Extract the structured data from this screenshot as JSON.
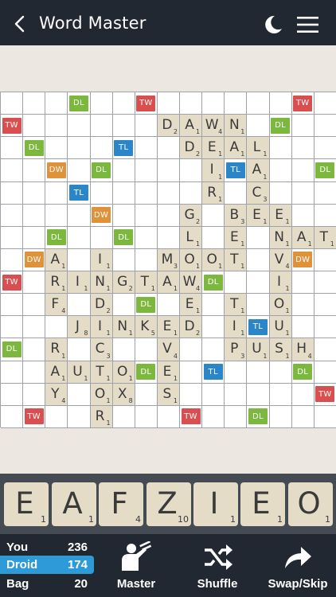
{
  "header": {
    "title": "Word Master"
  },
  "board": {
    "bonus": [
      [
        0,
        3,
        "DL"
      ],
      [
        0,
        6,
        "TW"
      ],
      [
        0,
        13,
        "TW"
      ],
      [
        1,
        0,
        "TW"
      ],
      [
        1,
        12,
        "DL"
      ],
      [
        2,
        1,
        "DL"
      ],
      [
        2,
        5,
        "TL"
      ],
      [
        3,
        2,
        "DW"
      ],
      [
        3,
        4,
        "DL"
      ],
      [
        3,
        10,
        "TL"
      ],
      [
        3,
        14,
        "DL"
      ],
      [
        4,
        3,
        "TL"
      ],
      [
        5,
        4,
        "DW"
      ],
      [
        6,
        2,
        "DL"
      ],
      [
        6,
        5,
        "DL"
      ],
      [
        7,
        1,
        "DW"
      ],
      [
        7,
        13,
        "DW"
      ],
      [
        8,
        0,
        "TW"
      ],
      [
        8,
        9,
        "DL"
      ],
      [
        9,
        6,
        "DL"
      ],
      [
        10,
        11,
        "TL"
      ],
      [
        11,
        0,
        "DL"
      ],
      [
        12,
        6,
        "DL"
      ],
      [
        12,
        9,
        "TL"
      ],
      [
        12,
        13,
        "DL"
      ],
      [
        13,
        14,
        "TW"
      ],
      [
        14,
        1,
        "TW"
      ],
      [
        14,
        8,
        "TW"
      ],
      [
        14,
        11,
        "DL"
      ]
    ],
    "tiles": [
      [
        1,
        7,
        "D",
        "2"
      ],
      [
        1,
        8,
        "A",
        "1"
      ],
      [
        1,
        9,
        "W",
        "4"
      ],
      [
        1,
        10,
        "N",
        "1"
      ],
      [
        2,
        8,
        "D",
        "2"
      ],
      [
        2,
        9,
        "E",
        "1"
      ],
      [
        2,
        10,
        "A",
        "1"
      ],
      [
        2,
        11,
        "L",
        "1"
      ],
      [
        3,
        9,
        "I",
        "1"
      ],
      [
        3,
        11,
        "A",
        "1"
      ],
      [
        4,
        9,
        "R",
        "1"
      ],
      [
        4,
        11,
        "C",
        "3"
      ],
      [
        5,
        8,
        "G",
        "2"
      ],
      [
        5,
        10,
        "B",
        "3"
      ],
      [
        5,
        11,
        "E",
        "1"
      ],
      [
        5,
        12,
        "E",
        "1"
      ],
      [
        6,
        8,
        "L",
        "1"
      ],
      [
        6,
        10,
        "E",
        "1"
      ],
      [
        6,
        12,
        "N",
        "1"
      ],
      [
        6,
        13,
        "A",
        "1"
      ],
      [
        6,
        14,
        "T",
        "1"
      ],
      [
        7,
        2,
        "A",
        "1"
      ],
      [
        7,
        4,
        "I",
        "1"
      ],
      [
        7,
        7,
        "M",
        "3"
      ],
      [
        7,
        8,
        "O",
        "1"
      ],
      [
        7,
        9,
        "O",
        "1"
      ],
      [
        7,
        10,
        "T",
        "1"
      ],
      [
        7,
        12,
        "V",
        "4"
      ],
      [
        8,
        2,
        "R",
        "1"
      ],
      [
        8,
        3,
        "I",
        "1"
      ],
      [
        8,
        4,
        "N",
        "1"
      ],
      [
        8,
        5,
        "G",
        "2"
      ],
      [
        8,
        6,
        "T",
        "1"
      ],
      [
        8,
        7,
        "A",
        "1"
      ],
      [
        8,
        8,
        "W",
        "4"
      ],
      [
        8,
        12,
        "I",
        "1"
      ],
      [
        9,
        2,
        "F",
        "4"
      ],
      [
        9,
        4,
        "D",
        "2"
      ],
      [
        9,
        8,
        "E",
        "1"
      ],
      [
        9,
        10,
        "T",
        "1"
      ],
      [
        9,
        12,
        "O",
        "1"
      ],
      [
        10,
        3,
        "J",
        "8"
      ],
      [
        10,
        4,
        "I",
        "1"
      ],
      [
        10,
        5,
        "N",
        "1"
      ],
      [
        10,
        6,
        "K",
        "5"
      ],
      [
        10,
        7,
        "E",
        "1"
      ],
      [
        10,
        8,
        "D",
        "2"
      ],
      [
        10,
        10,
        "I",
        "1"
      ],
      [
        10,
        12,
        "U",
        "1"
      ],
      [
        11,
        2,
        "R",
        "1"
      ],
      [
        11,
        4,
        "C",
        "3"
      ],
      [
        11,
        7,
        "V",
        "4"
      ],
      [
        11,
        10,
        "P",
        "3"
      ],
      [
        11,
        11,
        "U",
        "1"
      ],
      [
        11,
        12,
        "S",
        "1"
      ],
      [
        11,
        13,
        "H",
        "4"
      ],
      [
        12,
        2,
        "A",
        "1"
      ],
      [
        12,
        3,
        "U",
        "1"
      ],
      [
        12,
        4,
        "T",
        "1"
      ],
      [
        12,
        5,
        "O",
        "1"
      ],
      [
        12,
        7,
        "E",
        "1"
      ],
      [
        13,
        2,
        "Y",
        "4"
      ],
      [
        13,
        4,
        "O",
        "1"
      ],
      [
        13,
        5,
        "X",
        "8"
      ],
      [
        13,
        7,
        "S",
        "1"
      ],
      [
        14,
        4,
        "R",
        "1"
      ]
    ]
  },
  "rack": [
    {
      "letter": "E",
      "points": "1"
    },
    {
      "letter": "A",
      "points": "1"
    },
    {
      "letter": "F",
      "points": "4"
    },
    {
      "letter": "Z",
      "points": "10"
    },
    {
      "letter": "I",
      "points": "1"
    },
    {
      "letter": "E",
      "points": "1"
    },
    {
      "letter": "O",
      "points": "1"
    }
  ],
  "scores": {
    "you": {
      "name": "You",
      "value": "236"
    },
    "droid": {
      "name": "Droid",
      "value": "174"
    },
    "bag": {
      "name": "Bag",
      "value": "20"
    }
  },
  "actions": {
    "master": "Master",
    "shuffle": "Shuffle",
    "swap": "Swap/Skip"
  },
  "colors": {
    "header": "#222831",
    "rack": "#444b53",
    "tile": "#e5dcc8",
    "TW": "#d94f50",
    "DW": "#e0923a",
    "DL": "#7cb83e",
    "TL": "#2a86c9",
    "active_score": "#2e9ad8"
  }
}
